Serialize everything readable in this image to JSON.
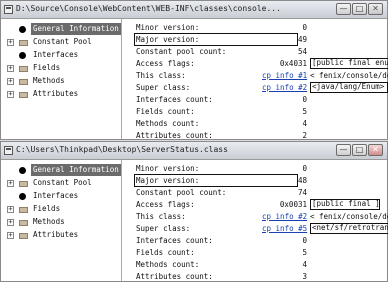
{
  "window1": {
    "title": "D:\\Source\\Console\\WebContent\\WEB-INF\\classes\\console...",
    "buttons": {
      "minimize": "—",
      "maximize": "□",
      "close": "✕"
    },
    "tree": [
      {
        "label": "General Information",
        "icon": "leaf",
        "selected": true
      },
      {
        "label": "Constant Pool",
        "icon": "folder",
        "expander": "+"
      },
      {
        "label": "Interfaces",
        "icon": "leaf"
      },
      {
        "label": "Fields",
        "icon": "folder",
        "expander": "+"
      },
      {
        "label": "Methods",
        "icon": "folder",
        "expander": "+"
      },
      {
        "label": "Attributes",
        "icon": "folder",
        "expander": "+"
      }
    ],
    "rows": [
      {
        "label": "Minor version:",
        "value": "0"
      },
      {
        "label": "Major version:",
        "value": "49"
      },
      {
        "label": "Constant pool count:",
        "value": "54"
      },
      {
        "label": "Access flags:",
        "value": "0x4031",
        "extra": "[public final  enum]"
      },
      {
        "label": "This class:",
        "value": "cp info #1",
        "extra": "< fenix/console/domai"
      },
      {
        "label": "Super class:",
        "value": "cp info #2",
        "extra": "<java/lang/Enum>"
      },
      {
        "label": "Interfaces count:",
        "value": "0"
      },
      {
        "label": "Fields count:",
        "value": "5"
      },
      {
        "label": "Methods count:",
        "value": "4"
      },
      {
        "label": "Attributes count:",
        "value": "2"
      }
    ]
  },
  "window2": {
    "title": "C:\\Users\\Thinkpad\\Desktop\\ServerStatus.class",
    "buttons": {
      "minimize": "—",
      "maximize": "□",
      "close": "✕"
    },
    "tree": [
      {
        "label": "General Information",
        "icon": "leaf",
        "selected": true
      },
      {
        "label": "Constant Pool",
        "icon": "folder",
        "expander": "+"
      },
      {
        "label": "Interfaces",
        "icon": "leaf"
      },
      {
        "label": "Fields",
        "icon": "folder",
        "expander": "+"
      },
      {
        "label": "Methods",
        "icon": "folder",
        "expander": "+"
      },
      {
        "label": "Attributes",
        "icon": "folder",
        "expander": "+"
      }
    ],
    "rows": [
      {
        "label": "Minor version:",
        "value": "0"
      },
      {
        "label": "Major version:",
        "value": "48"
      },
      {
        "label": "Constant pool count:",
        "value": "74"
      },
      {
        "label": "Access flags:",
        "value": "0x0031",
        "extra": "[public final ]"
      },
      {
        "label": "This class:",
        "value": "cp info #2",
        "extra": "< fenix/console/domai"
      },
      {
        "label": "Super class:",
        "value": "cp info #5",
        "extra": "<net/sf/retrotranslat"
      },
      {
        "label": "Interfaces count:",
        "value": "0"
      },
      {
        "label": "Fields count:",
        "value": "5"
      },
      {
        "label": "Methods count:",
        "value": "4"
      },
      {
        "label": "Attributes count:",
        "value": "3"
      }
    ]
  }
}
